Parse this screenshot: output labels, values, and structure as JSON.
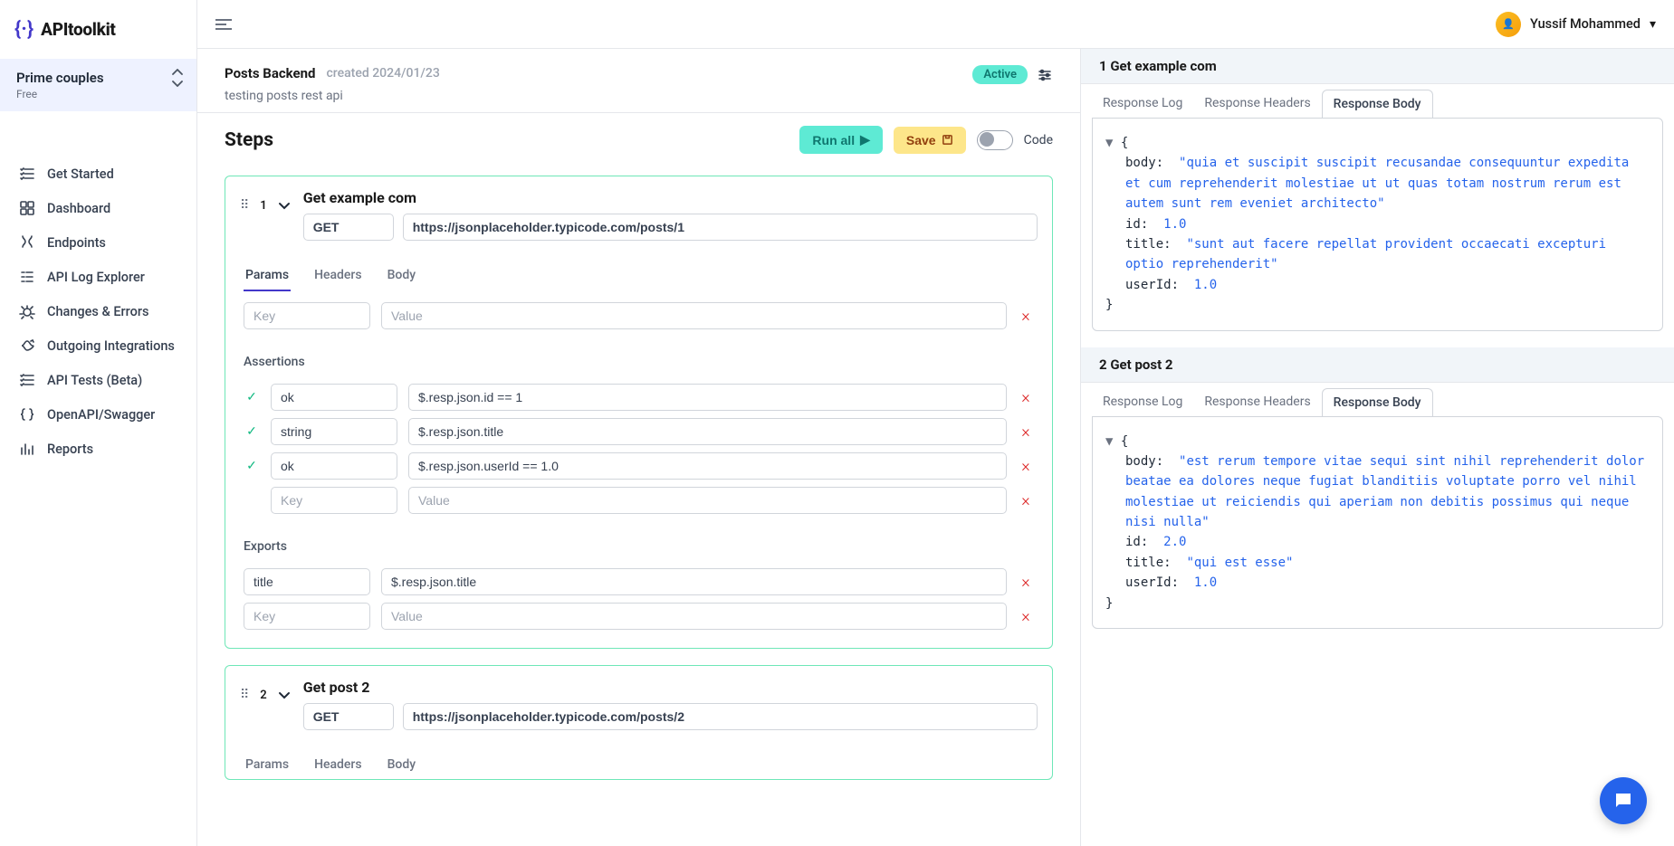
{
  "brand": "APItoolkit",
  "user": {
    "name": "Yussif Mohammed"
  },
  "project": {
    "name": "Prime couples",
    "plan": "Free"
  },
  "nav": [
    {
      "label": "Get Started",
      "icon": "checklist-icon"
    },
    {
      "label": "Dashboard",
      "icon": "dashboard-icon"
    },
    {
      "label": "Endpoints",
      "icon": "endpoints-icon"
    },
    {
      "label": "API Log Explorer",
      "icon": "log-icon"
    },
    {
      "label": "Changes & Errors",
      "icon": "bug-icon"
    },
    {
      "label": "Outgoing Integrations",
      "icon": "outgoing-icon"
    },
    {
      "label": "API Tests (Beta)",
      "icon": "checklist-icon"
    },
    {
      "label": "OpenAPI/Swagger",
      "icon": "braces-icon"
    },
    {
      "label": "Reports",
      "icon": "reports-icon"
    }
  ],
  "test": {
    "title": "Posts Backend",
    "created": "created 2024/01/23",
    "desc": "testing posts rest api",
    "status": "Active"
  },
  "stepsHeader": {
    "title": "Steps",
    "run": "Run all",
    "save": "Save",
    "code": "Code"
  },
  "placeholders": {
    "key": "Key",
    "value": "Value"
  },
  "stepTabs": {
    "params": "Params",
    "headers": "Headers",
    "body": "Body"
  },
  "sectionLabels": {
    "assertions": "Assertions",
    "exports": "Exports"
  },
  "steps": [
    {
      "num": "1",
      "name": "Get example com",
      "method": "GET",
      "url": "https://jsonplaceholder.typicode.com/posts/1",
      "assertions": [
        {
          "key": "ok",
          "value": "$.resp.json.id == 1",
          "pass": true
        },
        {
          "key": "string",
          "value": "$.resp.json.title",
          "pass": true
        },
        {
          "key": "ok",
          "value": "$.resp.json.userId == 1.0",
          "pass": true
        }
      ],
      "exports": [
        {
          "key": "title",
          "value": "$.resp.json.title"
        }
      ]
    },
    {
      "num": "2",
      "name": "Get post 2",
      "method": "GET",
      "url": "https://jsonplaceholder.typicode.com/posts/2"
    }
  ],
  "resultTabs": {
    "log": "Response Log",
    "headers": "Response Headers",
    "body": "Response Body"
  },
  "results": [
    {
      "title": "1 Get example com",
      "json": {
        "body": "\"quia et suscipit suscipit recusandae consequuntur expedita et cum reprehenderit molestiae ut ut quas totam nostrum rerum est autem sunt rem eveniet architecto\"",
        "id": "1.0",
        "title_v": "\"sunt aut facere repellat provident occaecati excepturi optio reprehenderit\"",
        "userId": "1.0"
      }
    },
    {
      "title": "2 Get post 2",
      "json": {
        "body": "\"est rerum tempore vitae sequi sint nihil reprehenderit dolor beatae ea dolores neque fugiat blanditiis voluptate porro vel nihil molestiae ut reiciendis qui aperiam non debitis possimus qui neque nisi nulla\"",
        "id": "2.0",
        "title_v": "\"qui est esse\"",
        "userId": "1.0"
      }
    }
  ]
}
